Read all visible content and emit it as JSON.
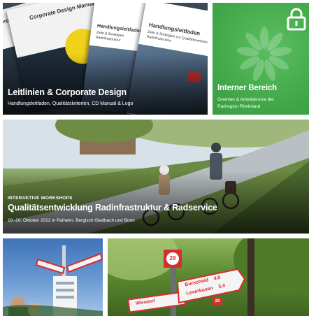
{
  "tile_design": {
    "title": "Leitlinien & Corporate Design",
    "subtitle": "Handlungsleitfaden, Qualitätskriterien, CD Manual & Logo",
    "brochure_back_title": "Corporate Design Manual",
    "brochure_mid_title": "Handlungsleitfaden",
    "brochure_front_title": "Handlungsleitfaden",
    "brochure_front_line1": "Ziele & Strategien zur Qualitätsverbesserung",
    "brochure_front_line2": "Radinfrastruktur",
    "brochure_mid_line1": "Ziele & Strategien",
    "brochure_mid_line2": "Radinfrastruktur"
  },
  "tile_internal": {
    "title": "Interner Bereich",
    "subtitle": "Gremien & Arbeitskreise der Radregion Rheinland",
    "lock_icon": "lock-icon",
    "logo_icon": "flower-logo-icon"
  },
  "tile_workshop": {
    "kicker": "INTERAKTIVE WORKSHOPS",
    "title": "Qualitätsentwicklung Radinfrastruktur & Radservice",
    "subtitle": "18.-20. Oktober 2022 in Pulheim, Bergisch Gladbach und Bonn"
  },
  "tile_signpost": {
    "icon": "signpost-icon"
  },
  "tile_forest_sign": {
    "route_number": "29",
    "sign_line1": "Burscheid",
    "sign_line1_dist": "4,8",
    "sign_line2": "Leverkusen",
    "sign_line2_dist": "3,4",
    "sign_left": "Wiesdorf",
    "route_number_small": "29"
  },
  "colors": {
    "green": "#43a94a",
    "sign_red": "#d42e2e"
  }
}
